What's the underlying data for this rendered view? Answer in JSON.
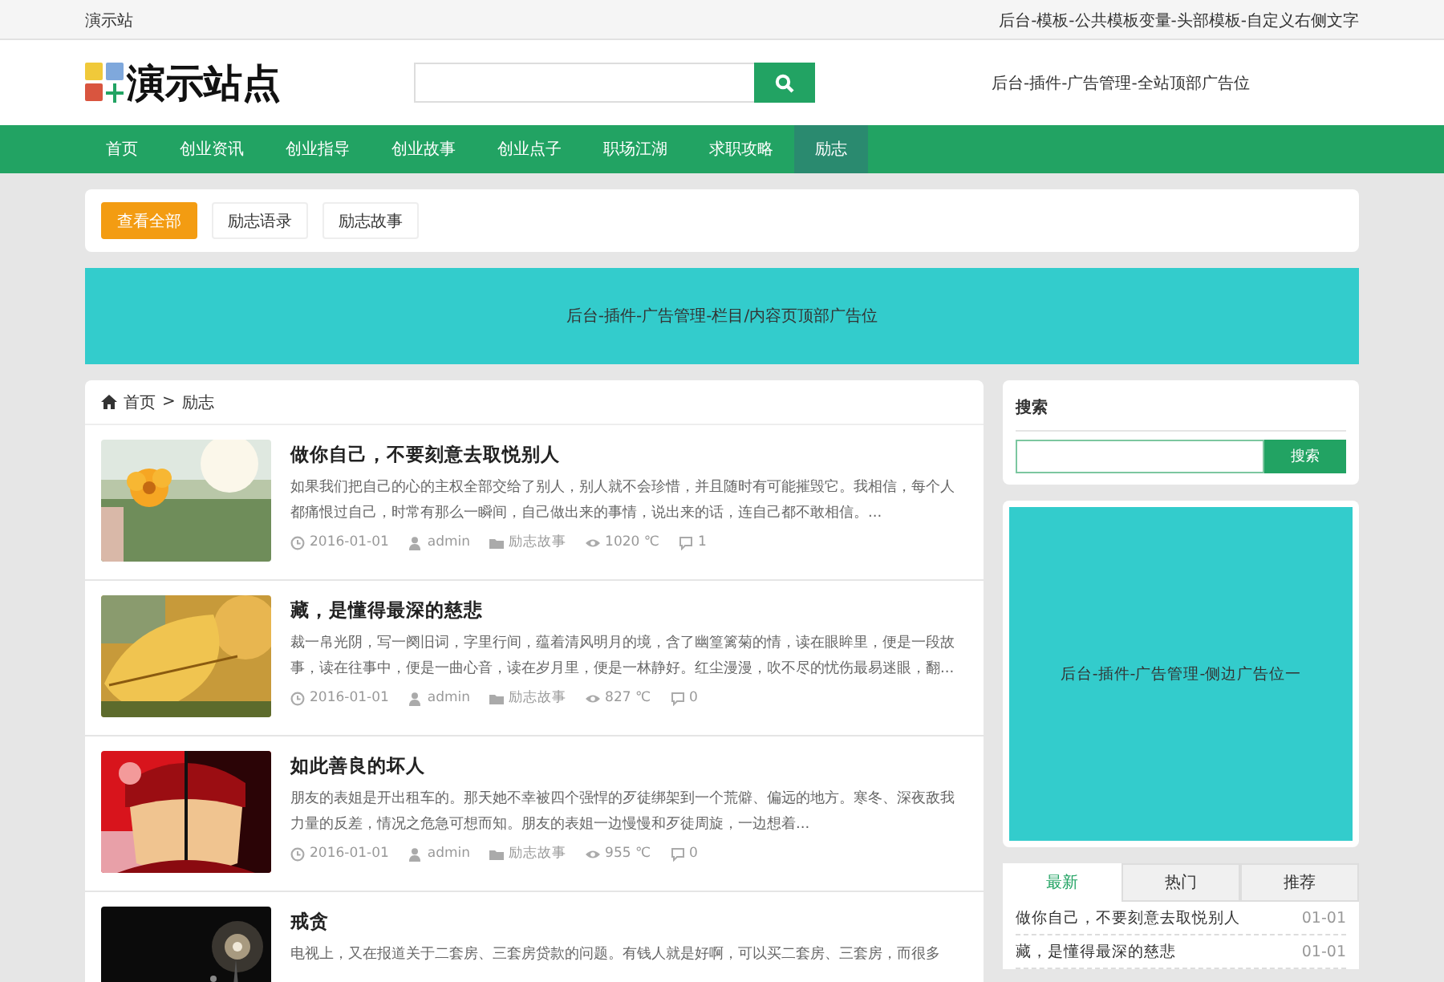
{
  "top_bar": {
    "site_name": "演示站",
    "right_text": "后台-模板-公共模板变量-头部模板-自定义右侧文字"
  },
  "header": {
    "logo_text": "演示站点",
    "ad_text": "后台-插件-广告管理-全站顶部广告位"
  },
  "nav": [
    {
      "label": "首页",
      "selected": false
    },
    {
      "label": "创业资讯",
      "selected": false
    },
    {
      "label": "创业指导",
      "selected": false
    },
    {
      "label": "创业故事",
      "selected": false
    },
    {
      "label": "创业点子",
      "selected": false
    },
    {
      "label": "职场江湖",
      "selected": false
    },
    {
      "label": "求职攻略",
      "selected": false
    },
    {
      "label": "励志",
      "selected": true
    }
  ],
  "filters": [
    {
      "label": "查看全部",
      "selected": true
    },
    {
      "label": "励志语录",
      "selected": false
    },
    {
      "label": "励志故事",
      "selected": false
    }
  ],
  "top_ad": "后台-插件-广告管理-栏目/内容页顶部广告位",
  "breadcrumb": [
    "首页",
    ">",
    "励志"
  ],
  "articles": [
    {
      "title": "做你自己，不要刻意去取悦别人",
      "excerpt": "如果我们把自己的心的主权全部交给了别人，别人就不会珍惜，并且随时有可能摧毁它。我相信，每个人都痛恨过自己，时常有那么一瞬间，自己做出来的事情，说出来的话，连自己都不敢相信。...",
      "date": "2016-01-01",
      "author": "admin",
      "category": "励志故事",
      "views": "1020 ℃",
      "comments": "1",
      "kind": "picture"
    },
    {
      "title": "藏，是懂得最深的慈悲",
      "excerpt": "裁一帛光阴，写一阕旧词，字里行间，蕴着清风明月的境，含了幽篁篱菊的情，读在眼眸里，便是一段故事，读在往事中，便是一曲心音，读在岁月里，便是一林静好。红尘漫漫，吹不尽的忧伤最易迷眼，翻...",
      "date": "2016-01-01",
      "author": "admin",
      "category": "励志故事",
      "views": "827 ℃",
      "comments": "0",
      "kind": "picture"
    },
    {
      "title": "如此善良的坏人",
      "excerpt": "朋友的表姐是开出租车的。那天她不幸被四个强悍的歹徒绑架到一个荒僻、偏远的地方。寒冬、深夜敌我力量的反差，情况之危急可想而知。朋友的表姐一边慢慢和歹徒周旋，一边想着...",
      "date": "2016-01-01",
      "author": "admin",
      "category": "励志故事",
      "views": "955 ℃",
      "comments": "0",
      "kind": "picture"
    },
    {
      "title": "戒贪",
      "excerpt": "电视上，又在报道关于二套房、三套房贷款的问题。有钱人就是好啊，可以买二套房、三套房，而很多",
      "kind": "picture"
    }
  ],
  "sidebar": {
    "search_title": "搜索",
    "search_button": "搜索",
    "ad_text": "后台-插件-广告管理-侧边广告位一",
    "tabs": [
      {
        "label": "最新",
        "selected": true
      },
      {
        "label": "热门",
        "selected": false
      },
      {
        "label": "推荐",
        "selected": false
      }
    ],
    "list": [
      {
        "title": "做你自己，不要刻意去取悦别人",
        "date": "01-01"
      },
      {
        "title": "藏，是懂得最深的慈悲",
        "date": "01-01"
      }
    ]
  }
}
